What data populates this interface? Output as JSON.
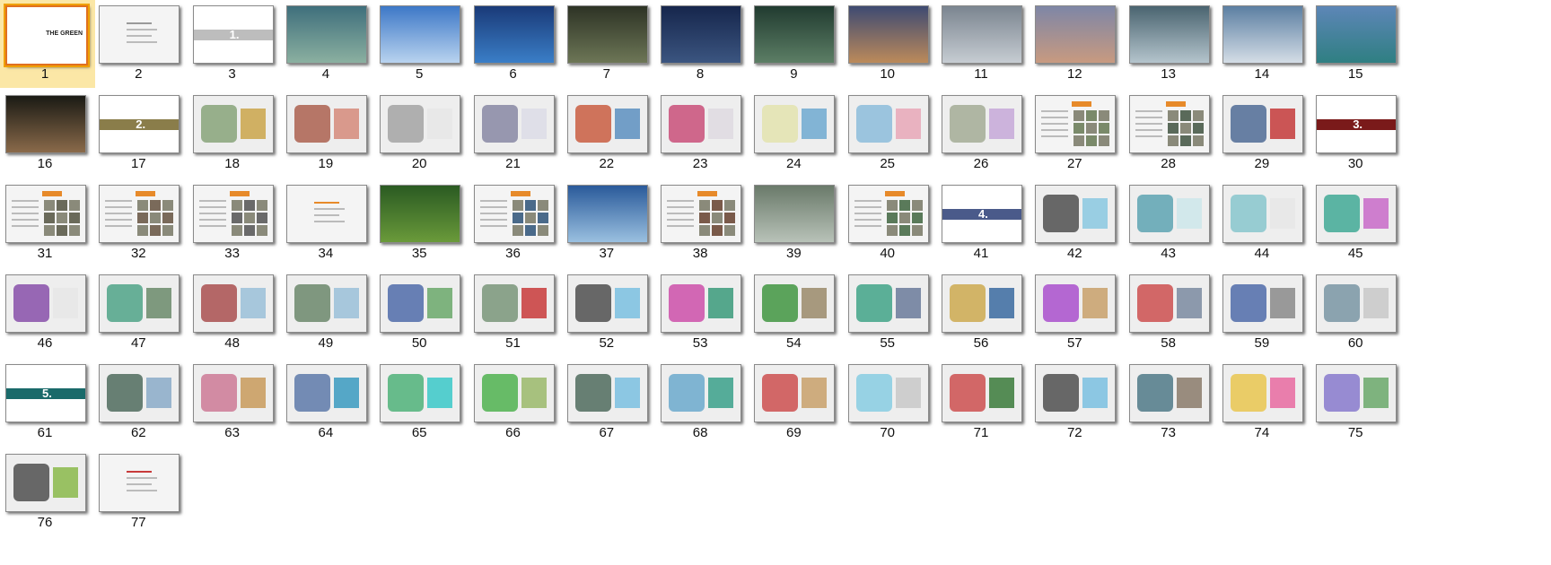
{
  "viewer": {
    "selected_slide": "1",
    "cover_title": "THE GREEN"
  },
  "slides": [
    {
      "num": "1",
      "kind": "cover"
    },
    {
      "num": "2",
      "kind": "text"
    },
    {
      "num": "3",
      "kind": "divider",
      "color": "#bdbdbd",
      "label": "1."
    },
    {
      "num": "4",
      "kind": "photo",
      "colors": [
        "#3f6f7c",
        "#8bb0a0"
      ]
    },
    {
      "num": "5",
      "kind": "photo",
      "colors": [
        "#3d78c7",
        "#b9d3ef"
      ]
    },
    {
      "num": "6",
      "kind": "photo",
      "colors": [
        "#1a3a78",
        "#3a7ec7"
      ]
    },
    {
      "num": "7",
      "kind": "photo",
      "colors": [
        "#2d3325",
        "#6d7656"
      ]
    },
    {
      "num": "8",
      "kind": "photo",
      "colors": [
        "#16264c",
        "#3b5580"
      ]
    },
    {
      "num": "9",
      "kind": "photo",
      "colors": [
        "#213b30",
        "#5c7e65"
      ]
    },
    {
      "num": "10",
      "kind": "photo",
      "colors": [
        "#3e4a72",
        "#bc8a5a"
      ]
    },
    {
      "num": "11",
      "kind": "photo",
      "colors": [
        "#7b8590",
        "#c6ccd2"
      ]
    },
    {
      "num": "12",
      "kind": "photo",
      "colors": [
        "#7e86a6",
        "#c89a80"
      ]
    },
    {
      "num": "13",
      "kind": "photo",
      "colors": [
        "#4a6470",
        "#b4c4cc"
      ]
    },
    {
      "num": "14",
      "kind": "photo",
      "colors": [
        "#5c7fa2",
        "#d4dde6"
      ]
    },
    {
      "num": "15",
      "kind": "photo",
      "colors": [
        "#5d86b7",
        "#2f7f82"
      ]
    },
    {
      "num": "16",
      "kind": "photo",
      "colors": [
        "#1a1a14",
        "#8a6a4a"
      ]
    },
    {
      "num": "17",
      "kind": "divider",
      "color": "#8a7d4a",
      "label": "2."
    },
    {
      "num": "18",
      "kind": "diagram",
      "colors": [
        "#7a9a6a",
        "#caa54a"
      ]
    },
    {
      "num": "19",
      "kind": "diagram",
      "colors": [
        "#a34d3a",
        "#d58a7a"
      ]
    },
    {
      "num": "20",
      "kind": "diagram",
      "colors": [
        "#9a9a9a",
        "#e6e6e6"
      ]
    },
    {
      "num": "21",
      "kind": "diagram",
      "colors": [
        "#7a7a9a",
        "#dcdce6"
      ]
    },
    {
      "num": "22",
      "kind": "diagram",
      "colors": [
        "#c44a2a",
        "#5c8fbf"
      ]
    },
    {
      "num": "23",
      "kind": "diagram",
      "colors": [
        "#c43a6a",
        "#ded9e0"
      ]
    },
    {
      "num": "24",
      "kind": "diagram",
      "colors": [
        "#e2e2a6",
        "#6fa9d0"
      ]
    },
    {
      "num": "25",
      "kind": "diagram",
      "colors": [
        "#7fb6d8",
        "#e7a7b7"
      ]
    },
    {
      "num": "26",
      "kind": "diagram",
      "colors": [
        "#9aa38a",
        "#c6a8d8"
      ]
    },
    {
      "num": "27",
      "kind": "text_photo",
      "colors": [
        "#e78a2a",
        "#7a8a6a"
      ]
    },
    {
      "num": "28",
      "kind": "text_photo",
      "colors": [
        "#e78a2a",
        "#5a6a5a"
      ]
    },
    {
      "num": "29",
      "kind": "diagram",
      "colors": [
        "#3a5a8a",
        "#c43a3a"
      ]
    },
    {
      "num": "30",
      "kind": "divider",
      "color": "#7a1a1a",
      "label": "3."
    },
    {
      "num": "31",
      "kind": "text_photo",
      "colors": [
        "#e78a2a",
        "#6a6a5a"
      ]
    },
    {
      "num": "32",
      "kind": "text_photo",
      "colors": [
        "#e78a2a",
        "#7a6a5a"
      ]
    },
    {
      "num": "33",
      "kind": "text_photo",
      "colors": [
        "#e78a2a",
        "#6a6a6a"
      ]
    },
    {
      "num": "34",
      "kind": "text",
      "colors": [
        "#e78a2a",
        "#8ac0c8"
      ]
    },
    {
      "num": "35",
      "kind": "photo",
      "colors": [
        "#2a5a22",
        "#6a9a3a"
      ]
    },
    {
      "num": "36",
      "kind": "text_photo",
      "colors": [
        "#e78a2a",
        "#4a6a8a"
      ]
    },
    {
      "num": "37",
      "kind": "photo",
      "colors": [
        "#2a5a9a",
        "#9ac0e0"
      ]
    },
    {
      "num": "38",
      "kind": "text_photo",
      "colors": [
        "#e78a2a",
        "#7a5a4a"
      ]
    },
    {
      "num": "39",
      "kind": "photo",
      "colors": [
        "#6a7a6a",
        "#b8c2b8"
      ]
    },
    {
      "num": "40",
      "kind": "text_photo",
      "colors": [
        "#e78a2a",
        "#5a7a5a"
      ]
    },
    {
      "num": "41",
      "kind": "divider",
      "color": "#4a5a8a",
      "label": "4."
    },
    {
      "num": "42",
      "kind": "diagram",
      "colors": [
        "#3a3a3a",
        "#8ac8e0"
      ]
    },
    {
      "num": "43",
      "kind": "diagram",
      "colors": [
        "#4a9aaa",
        "#cde6ea"
      ]
    },
    {
      "num": "44",
      "kind": "diagram",
      "colors": [
        "#7ac0c8",
        "#e6e6e6"
      ]
    },
    {
      "num": "45",
      "kind": "diagram",
      "colors": [
        "#2aa08a",
        "#c86ac8"
      ]
    },
    {
      "num": "46",
      "kind": "diagram",
      "colors": [
        "#7a3aa0",
        "#e6e6e6"
      ]
    },
    {
      "num": "47",
      "kind": "diagram",
      "colors": [
        "#3a9a7a",
        "#6a8a6a"
      ]
    },
    {
      "num": "48",
      "kind": "diagram",
      "colors": [
        "#a03a3a",
        "#9ac0d8"
      ]
    },
    {
      "num": "49",
      "kind": "diagram",
      "colors": [
        "#5a7a5a",
        "#9ac0d8"
      ]
    },
    {
      "num": "50",
      "kind": "diagram",
      "colors": [
        "#3a5aa0",
        "#6aa86a"
      ]
    },
    {
      "num": "51",
      "kind": "diagram",
      "colors": [
        "#6a8a6a",
        "#c83a3a"
      ]
    },
    {
      "num": "52",
      "kind": "diagram",
      "colors": [
        "#3a3a3a",
        "#7ac0e0"
      ]
    },
    {
      "num": "53",
      "kind": "diagram",
      "colors": [
        "#c83aa0",
        "#3a9a7a"
      ]
    },
    {
      "num": "54",
      "kind": "diagram",
      "colors": [
        "#2a8a2a",
        "#9a8a6a"
      ]
    },
    {
      "num": "55",
      "kind": "diagram",
      "colors": [
        "#2a9a7a",
        "#6a7a9a"
      ]
    },
    {
      "num": "56",
      "kind": "diagram",
      "colors": [
        "#c8a03a",
        "#3a6aa0"
      ]
    },
    {
      "num": "57",
      "kind": "diagram",
      "colors": [
        "#a03ac8",
        "#c8a06a"
      ]
    },
    {
      "num": "58",
      "kind": "diagram",
      "colors": [
        "#c83a3a",
        "#7a8aa0"
      ]
    },
    {
      "num": "59",
      "kind": "diagram",
      "colors": [
        "#3a5aa0",
        "#8a8a8a"
      ]
    },
    {
      "num": "60",
      "kind": "diagram",
      "colors": [
        "#6a8a9a",
        "#c8c8c8"
      ]
    },
    {
      "num": "61",
      "kind": "divider",
      "color": "#1a6a6a",
      "label": "5."
    },
    {
      "num": "62",
      "kind": "diagram",
      "colors": [
        "#3a5a4a",
        "#8aaac8"
      ]
    },
    {
      "num": "63",
      "kind": "diagram",
      "colors": [
        "#c86a8a",
        "#c89a5a"
      ]
    },
    {
      "num": "64",
      "kind": "diagram",
      "colors": [
        "#4a6aa0",
        "#3a9ac0"
      ]
    },
    {
      "num": "65",
      "kind": "diagram",
      "colors": [
        "#3aaa6a",
        "#3ac8c8"
      ]
    },
    {
      "num": "66",
      "kind": "diagram",
      "colors": [
        "#3aaa3a",
        "#9ab86a"
      ]
    },
    {
      "num": "67",
      "kind": "diagram",
      "colors": [
        "#3a5a4a",
        "#7ac0e0"
      ]
    },
    {
      "num": "68",
      "kind": "diagram",
      "colors": [
        "#5aa0c8",
        "#3aa08a"
      ]
    },
    {
      "num": "69",
      "kind": "diagram",
      "colors": [
        "#c83a3a",
        "#c8a06a"
      ]
    },
    {
      "num": "70",
      "kind": "diagram",
      "colors": [
        "#7ac8e0",
        "#c8c8c8"
      ]
    },
    {
      "num": "71",
      "kind": "diagram",
      "colors": [
        "#c83a3a",
        "#3a7a3a"
      ]
    },
    {
      "num": "72",
      "kind": "diagram",
      "colors": [
        "#3a3a3a",
        "#7ac0e0"
      ]
    },
    {
      "num": "73",
      "kind": "diagram",
      "colors": [
        "#3a6a7a",
        "#8a7a6a"
      ]
    },
    {
      "num": "74",
      "kind": "diagram",
      "colors": [
        "#e8c03a",
        "#e86aa0"
      ]
    },
    {
      "num": "75",
      "kind": "diagram",
      "colors": [
        "#7a6ac8",
        "#6aa86a"
      ]
    },
    {
      "num": "76",
      "kind": "diagram",
      "colors": [
        "#3a3a3a",
        "#8ab84a"
      ]
    },
    {
      "num": "77",
      "kind": "text",
      "colors": [
        "#c83a3a",
        "#e6e6e6"
      ]
    }
  ]
}
